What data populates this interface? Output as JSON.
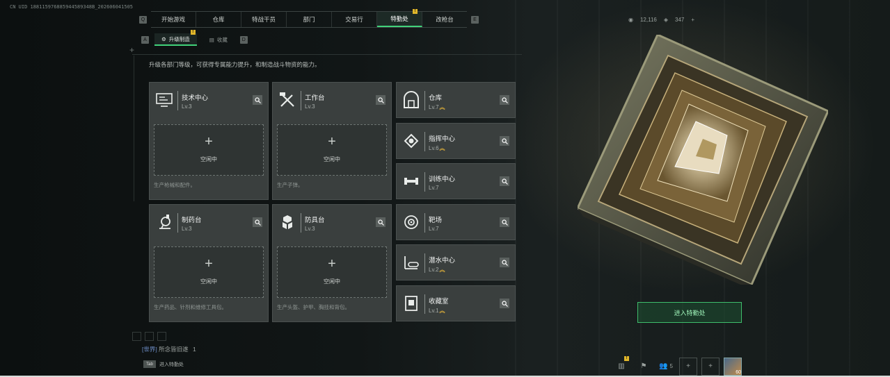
{
  "uid": "CN UID 188115976885944589348B_202606041505",
  "top_tabs": [
    {
      "label": "开始游戏",
      "active": false,
      "badge": ""
    },
    {
      "label": "仓库",
      "active": false,
      "badge": ""
    },
    {
      "label": "特战干员",
      "active": false,
      "badge": ""
    },
    {
      "label": "部门",
      "active": false,
      "badge": ""
    },
    {
      "label": "交易行",
      "active": false,
      "badge": ""
    },
    {
      "label": "特勤处",
      "active": true,
      "badge": "!"
    },
    {
      "label": "改枪台",
      "active": false,
      "badge": ""
    }
  ],
  "key_hints": {
    "left": "Q",
    "right": "E",
    "sub_left": "A",
    "sub_right": "D"
  },
  "currency": {
    "a": "12,116",
    "b": "347",
    "add": "+"
  },
  "sub_tabs": [
    {
      "label": "升级制造",
      "active": true,
      "badge": "!"
    },
    {
      "label": "收藏",
      "active": false,
      "badge": ""
    }
  ],
  "description": "升级各部门等级，可获得专属能力提升，和制造战斗物资的能力。",
  "workshops": [
    {
      "name": "技术中心",
      "level": "Lv.3",
      "icon": "computer-icon",
      "slot": "空闲中",
      "foot": "生产枪械和配件。"
    },
    {
      "name": "工作台",
      "level": "Lv.3",
      "icon": "tools-icon",
      "slot": "空闲中",
      "foot": "生产子弹。"
    },
    {
      "name": "制药台",
      "level": "Lv.3",
      "icon": "microscope-icon",
      "slot": "空闲中",
      "foot": "生产药品、针剂和维修工具包。"
    },
    {
      "name": "防具台",
      "level": "Lv.3",
      "icon": "armor-icon",
      "slot": "空闲中",
      "foot": "生产头盔、护甲、胸挂和背包。"
    }
  ],
  "facilities": [
    {
      "name": "仓库",
      "level": "Lv.7",
      "upgrade": true,
      "icon": "warehouse-icon"
    },
    {
      "name": "指挥中心",
      "level": "Lv.6",
      "upgrade": true,
      "icon": "command-chip-icon"
    },
    {
      "name": "训练中心",
      "level": "Lv.7",
      "upgrade": false,
      "icon": "dumbbell-icon"
    },
    {
      "name": "靶场",
      "level": "Lv.7",
      "upgrade": false,
      "icon": "target-icon"
    },
    {
      "name": "潜水中心",
      "level": "Lv.2",
      "upgrade": true,
      "icon": "diving-icon"
    },
    {
      "name": "收藏室",
      "level": "Lv.1",
      "upgrade": true,
      "icon": "collection-icon"
    }
  ],
  "plus_glyph": "+",
  "upgrade_glyph": "︽",
  "enter_button": "进入特勤处",
  "chat": {
    "channel": "[世界]",
    "text": "所念皆旧遂",
    "count": "1"
  },
  "tab_hint": {
    "key": "Tab",
    "label": "进入特勤处"
  },
  "bottom_bar": {
    "friends_count": "5",
    "avatar_level": "60"
  },
  "colors": {
    "accent": "#41d27a",
    "badge": "#e0b62a",
    "upgrade": "#d9ac3a",
    "card": "#3a3f3e"
  }
}
